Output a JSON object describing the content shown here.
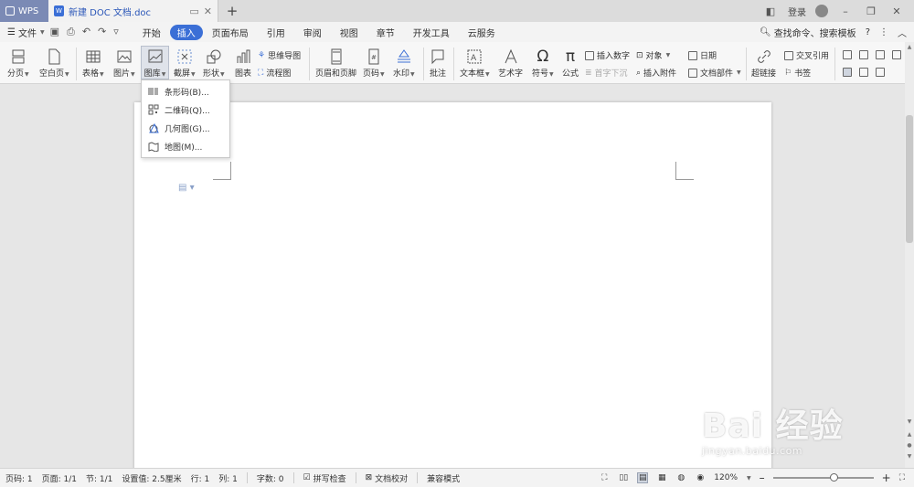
{
  "titlebar": {
    "wps_tab": "WPS",
    "doc_tab": "新建 DOC 文档.doc",
    "login": "登录"
  },
  "menubar": {
    "file": "文件",
    "tabs": [
      "开始",
      "插入",
      "页面布局",
      "引用",
      "审阅",
      "视图",
      "章节",
      "开发工具",
      "云服务"
    ],
    "active_tab": "插入",
    "search": "查找命令、搜索模板",
    "help": "?"
  },
  "ribbon": {
    "page_break": "分页",
    "blank_page": "空白页",
    "table": "表格",
    "picture": "图片",
    "gallery": "图库",
    "screenshot": "截屏",
    "shapes": "形状",
    "chart": "图表",
    "mindmap": "思维导图",
    "flowchart": "流程图",
    "header_footer": "页眉和页脚",
    "page_number": "页码",
    "watermark": "水印",
    "comment": "批注",
    "textbox": "文本框",
    "wordart": "艺术字",
    "symbol": "符号",
    "formula": "公式",
    "insert_number": "插入数字",
    "drop_cap": "首字下沉",
    "object": "对象",
    "insert_attachment": "插入附件",
    "date": "日期",
    "doc_parts": "文档部件",
    "hyperlink": "超链接",
    "cross_ref": "交叉引用",
    "bookmark": "书签"
  },
  "gallery_menu": {
    "items": [
      {
        "label": "条形码(B)...",
        "icon": "barcode-icon"
      },
      {
        "label": "二维码(Q)...",
        "icon": "qrcode-icon"
      },
      {
        "label": "几何图(G)...",
        "icon": "geometry-icon"
      },
      {
        "label": "地图(M)...",
        "icon": "map-icon"
      }
    ]
  },
  "statusbar": {
    "page_no": "页码: 1",
    "pages": "页面: 1/1",
    "section": "节: 1/1",
    "setting": "设置值: 2.5厘米",
    "row": "行: 1",
    "col": "列: 1",
    "words": "字数: 0",
    "spell_check": "拼写检查",
    "doc_proof": "文档校对",
    "compat_mode": "兼容模式",
    "zoom": "120%",
    "zoom_level": 0.6
  },
  "watermark": {
    "big": "Bai 经验",
    "small": "jingyan.baidu.com"
  }
}
